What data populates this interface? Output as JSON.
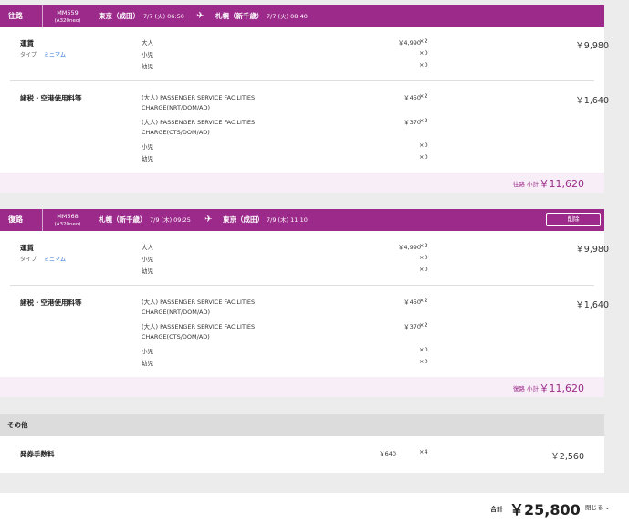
{
  "outbound": {
    "direction": "往路",
    "flight_no": "MM559",
    "aircraft": "(A320neo)",
    "dep_city": "東京（成田）",
    "dep_time": "7/7 (火) 06:50",
    "arr_city": "札幌（新千歳）",
    "arr_time": "7/7 (火) 08:40",
    "fare_label": "運賃",
    "type_label": "タイプ",
    "type_value": "ミニマム",
    "fare_rows": [
      {
        "pax": "大人",
        "unit": "￥4,990",
        "qty": "×2"
      },
      {
        "pax": "小児",
        "unit": "",
        "qty": "×0"
      },
      {
        "pax": "幼児",
        "unit": "",
        "qty": "×0"
      }
    ],
    "fare_amount": "￥9,980",
    "tax_label": "諸税・空港使用料等",
    "tax_rows": [
      {
        "pax": "(大人) PASSENGER SERVICE FACILITIES",
        "unit": "￥450",
        "qty": "×2"
      },
      {
        "pax": "CHARGE(NRT/DOM/AD)",
        "unit": "",
        "qty": ""
      },
      {
        "pax": "(大人) PASSENGER SERVICE FACILITIES",
        "unit": "￥370",
        "qty": "×2"
      },
      {
        "pax": "CHARGE(CTS/DOM/AD)",
        "unit": "",
        "qty": ""
      },
      {
        "pax": "小児",
        "unit": "",
        "qty": "×0"
      },
      {
        "pax": "幼児",
        "unit": "",
        "qty": "×0"
      }
    ],
    "tax_amount": "￥1,640",
    "subtotal_label": "往路 小計",
    "subtotal_value": "￥11,620"
  },
  "inbound": {
    "direction": "復路",
    "flight_no": "MM568",
    "aircraft": "(A320neo)",
    "dep_city": "札幌（新千歳）",
    "dep_time": "7/9 (木) 09:25",
    "arr_city": "東京（成田）",
    "arr_time": "7/9 (木) 11:10",
    "delete_label": "削除",
    "fare_label": "運賃",
    "type_label": "タイプ",
    "type_value": "ミニマム",
    "fare_rows": [
      {
        "pax": "大人",
        "unit": "￥4,990",
        "qty": "×2"
      },
      {
        "pax": "小児",
        "unit": "",
        "qty": "×0"
      },
      {
        "pax": "幼児",
        "unit": "",
        "qty": "×0"
      }
    ],
    "fare_amount": "￥9,980",
    "tax_label": "諸税・空港使用料等",
    "tax_rows": [
      {
        "pax": "(大人) PASSENGER SERVICE FACILITIES",
        "unit": "￥450",
        "qty": "×2"
      },
      {
        "pax": "CHARGE(NRT/DOM/AD)",
        "unit": "",
        "qty": ""
      },
      {
        "pax": "(大人) PASSENGER SERVICE FACILITIES",
        "unit": "￥370",
        "qty": "×2"
      },
      {
        "pax": "CHARGE(CTS/DOM/AD)",
        "unit": "",
        "qty": ""
      },
      {
        "pax": "小児",
        "unit": "",
        "qty": "×0"
      },
      {
        "pax": "幼児",
        "unit": "",
        "qty": "×0"
      }
    ],
    "tax_amount": "￥1,640",
    "subtotal_label": "復路 小計",
    "subtotal_value": "￥11,620"
  },
  "other": {
    "header": "その他",
    "fee_label": "発券手数料",
    "fee_unit": "￥640",
    "fee_qty": "×4",
    "fee_amount": "￥2,560"
  },
  "footer": {
    "total_label": "合計",
    "total_value": "￥25,800",
    "close_label": "閉じる ⌄"
  },
  "colors": {
    "brand": "#9b2a8a",
    "subtotal_bg": "#f8eef7",
    "link": "#2a6fd6"
  },
  "icons": [
    "plane-icon",
    "chevron-down-icon"
  ]
}
